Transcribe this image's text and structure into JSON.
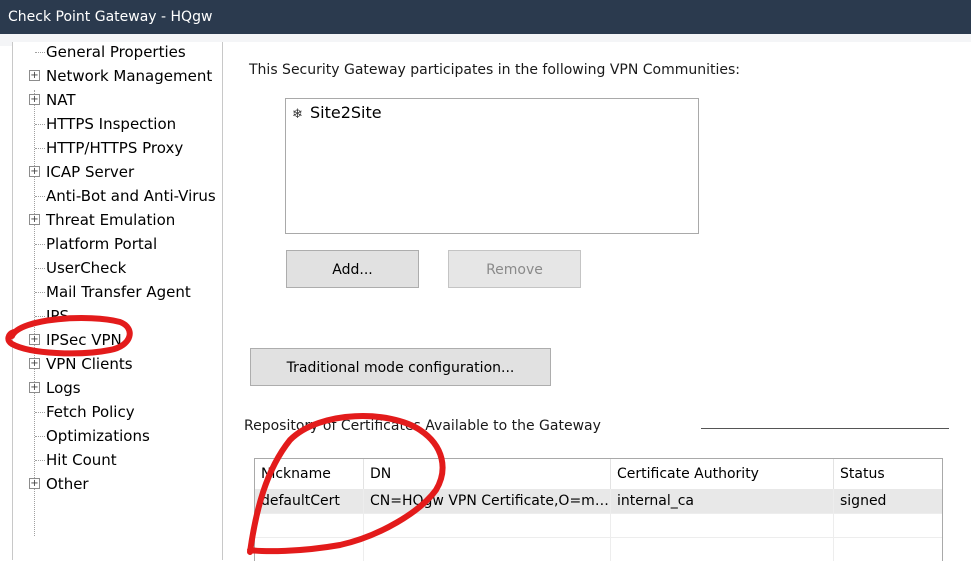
{
  "window": {
    "title": "Check Point Gateway - HQgw"
  },
  "tree": {
    "items": [
      {
        "label": "General Properties",
        "expandable": false
      },
      {
        "label": "Network Management",
        "expandable": true
      },
      {
        "label": "NAT",
        "expandable": true
      },
      {
        "label": "HTTPS Inspection",
        "expandable": false
      },
      {
        "label": "HTTP/HTTPS Proxy",
        "expandable": false
      },
      {
        "label": "ICAP Server",
        "expandable": true
      },
      {
        "label": "Anti-Bot and Anti-Virus",
        "expandable": false
      },
      {
        "label": "Threat Emulation",
        "expandable": true
      },
      {
        "label": "Platform Portal",
        "expandable": false
      },
      {
        "label": "UserCheck",
        "expandable": false
      },
      {
        "label": "Mail Transfer Agent",
        "expandable": false
      },
      {
        "label": "IPS",
        "expandable": false
      },
      {
        "label": "IPSec VPN",
        "expandable": true,
        "selected": true
      },
      {
        "label": "VPN Clients",
        "expandable": true
      },
      {
        "label": "Logs",
        "expandable": true
      },
      {
        "label": "Fetch Policy",
        "expandable": false
      },
      {
        "label": "Optimizations",
        "expandable": false
      },
      {
        "label": "Hit Count",
        "expandable": false
      },
      {
        "label": "Other",
        "expandable": true
      }
    ]
  },
  "vpn": {
    "communities_label": "This Security Gateway participates in the following VPN Communities:",
    "communities": [
      {
        "name": "Site2Site",
        "icon": "community-icon"
      }
    ],
    "add_label": "Add...",
    "remove_label": "Remove",
    "traditional_label": "Traditional mode configuration...",
    "repository_label": "Repository of Certificates Available to the Gateway"
  },
  "certificates": {
    "columns": [
      "Nickname",
      "DN",
      "Certificate Authority",
      "Status"
    ],
    "rows": [
      {
        "nickname": "defaultCert",
        "dn": "CN=HQgw VPN Certificate,O=mg...",
        "ca": "internal_ca",
        "status": "signed"
      }
    ]
  },
  "colors": {
    "titlebar": "#2b3a4e",
    "annotation": "#e31b1b"
  }
}
